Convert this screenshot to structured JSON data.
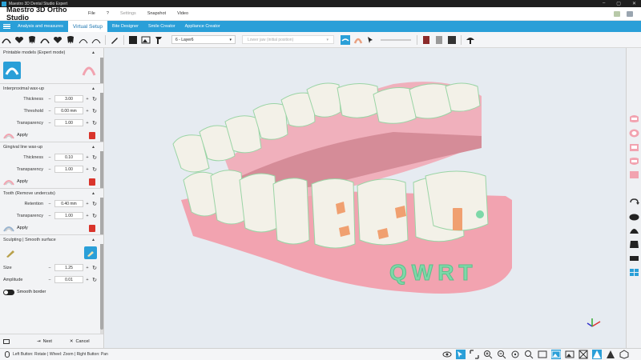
{
  "window": {
    "title": "Maestro 3D Dental Studio Expert"
  },
  "menubar": {
    "brand": "Maestro 3D Ortho Studio",
    "items": [
      "File",
      "?",
      "Settings",
      "Snapshot",
      "Video"
    ]
  },
  "tabs": [
    {
      "label": "Analysis and measures",
      "active": false
    },
    {
      "label": "Virtual Setup",
      "active": true
    },
    {
      "label": "Bite Designer",
      "active": false
    },
    {
      "label": "Smile Creator",
      "active": false
    },
    {
      "label": "Appliance Creator",
      "active": false
    }
  ],
  "toolbar": {
    "layer_select": "6 - Layer6",
    "jaw_select": "Lower jaw (initial position)"
  },
  "panel": {
    "printable_models": {
      "title": "Printable models (Expert mode)"
    },
    "interproximal": {
      "title": "Interproximal wax-up",
      "params": [
        {
          "label": "Thickness",
          "value": "3.00"
        },
        {
          "label": "Threshold",
          "value": "0.00 mm"
        },
        {
          "label": "Transparency",
          "value": "1.00"
        }
      ],
      "apply": "Apply"
    },
    "gingival": {
      "title": "Gingival line  wax-up",
      "params": [
        {
          "label": "Thickness",
          "value": "0.10"
        },
        {
          "label": "Transparency",
          "value": "1.00"
        }
      ],
      "apply": "Apply"
    },
    "tooth": {
      "title": "Tooth (Remove undercuts)",
      "params": [
        {
          "label": "Retention",
          "value": "0.40 mm"
        },
        {
          "label": "Transparency",
          "value": "1.00"
        }
      ],
      "apply": "Apply"
    },
    "sculpting": {
      "title": "Sculpting | Smooth surface",
      "params": [
        {
          "label": "Size",
          "value": "1.25"
        },
        {
          "label": "Amplitude",
          "value": "0.01"
        }
      ],
      "smooth_border": "Smooth border"
    },
    "footer": {
      "next": "Next",
      "cancel": "Cancel"
    }
  },
  "viewport": {
    "model_text": "QWRT"
  },
  "statusbar": {
    "hint": "Left Button: Rotate | Wheel: Zoom | Right Button: Pan"
  },
  "colors": {
    "accent": "#2a9fd8",
    "gum": "#f2a3b0",
    "tooth": "#f3f1e8",
    "trash": "#d9342b",
    "attachment": "#f0a070",
    "label_green": "#7dd8a8"
  }
}
